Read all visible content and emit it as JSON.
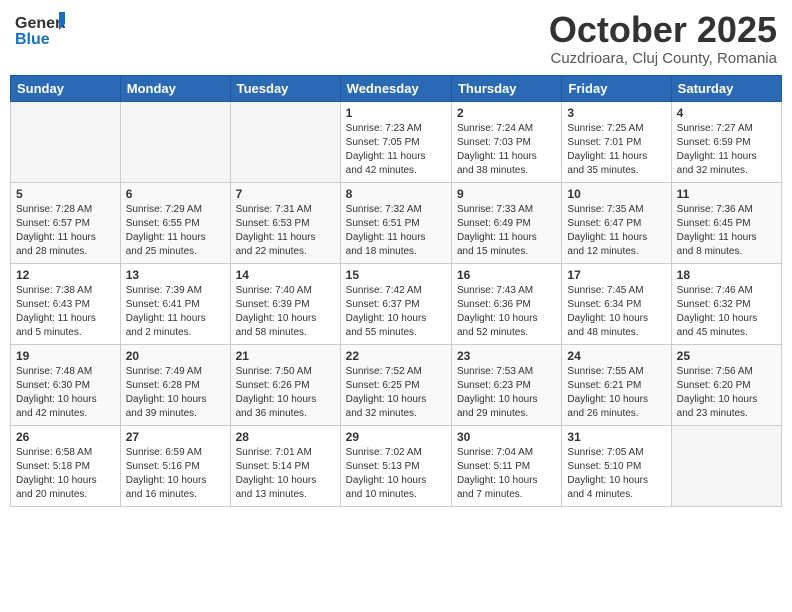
{
  "header": {
    "logo_general": "General",
    "logo_blue": "Blue",
    "month_title": "October 2025",
    "subtitle": "Cuzdrioara, Cluj County, Romania"
  },
  "weekdays": [
    "Sunday",
    "Monday",
    "Tuesday",
    "Wednesday",
    "Thursday",
    "Friday",
    "Saturday"
  ],
  "weeks": [
    [
      {
        "day": "",
        "info": ""
      },
      {
        "day": "",
        "info": ""
      },
      {
        "day": "",
        "info": ""
      },
      {
        "day": "1",
        "info": "Sunrise: 7:23 AM\nSunset: 7:05 PM\nDaylight: 11 hours\nand 42 minutes."
      },
      {
        "day": "2",
        "info": "Sunrise: 7:24 AM\nSunset: 7:03 PM\nDaylight: 11 hours\nand 38 minutes."
      },
      {
        "day": "3",
        "info": "Sunrise: 7:25 AM\nSunset: 7:01 PM\nDaylight: 11 hours\nand 35 minutes."
      },
      {
        "day": "4",
        "info": "Sunrise: 7:27 AM\nSunset: 6:59 PM\nDaylight: 11 hours\nand 32 minutes."
      }
    ],
    [
      {
        "day": "5",
        "info": "Sunrise: 7:28 AM\nSunset: 6:57 PM\nDaylight: 11 hours\nand 28 minutes."
      },
      {
        "day": "6",
        "info": "Sunrise: 7:29 AM\nSunset: 6:55 PM\nDaylight: 11 hours\nand 25 minutes."
      },
      {
        "day": "7",
        "info": "Sunrise: 7:31 AM\nSunset: 6:53 PM\nDaylight: 11 hours\nand 22 minutes."
      },
      {
        "day": "8",
        "info": "Sunrise: 7:32 AM\nSunset: 6:51 PM\nDaylight: 11 hours\nand 18 minutes."
      },
      {
        "day": "9",
        "info": "Sunrise: 7:33 AM\nSunset: 6:49 PM\nDaylight: 11 hours\nand 15 minutes."
      },
      {
        "day": "10",
        "info": "Sunrise: 7:35 AM\nSunset: 6:47 PM\nDaylight: 11 hours\nand 12 minutes."
      },
      {
        "day": "11",
        "info": "Sunrise: 7:36 AM\nSunset: 6:45 PM\nDaylight: 11 hours\nand 8 minutes."
      }
    ],
    [
      {
        "day": "12",
        "info": "Sunrise: 7:38 AM\nSunset: 6:43 PM\nDaylight: 11 hours\nand 5 minutes."
      },
      {
        "day": "13",
        "info": "Sunrise: 7:39 AM\nSunset: 6:41 PM\nDaylight: 11 hours\nand 2 minutes."
      },
      {
        "day": "14",
        "info": "Sunrise: 7:40 AM\nSunset: 6:39 PM\nDaylight: 10 hours\nand 58 minutes."
      },
      {
        "day": "15",
        "info": "Sunrise: 7:42 AM\nSunset: 6:37 PM\nDaylight: 10 hours\nand 55 minutes."
      },
      {
        "day": "16",
        "info": "Sunrise: 7:43 AM\nSunset: 6:36 PM\nDaylight: 10 hours\nand 52 minutes."
      },
      {
        "day": "17",
        "info": "Sunrise: 7:45 AM\nSunset: 6:34 PM\nDaylight: 10 hours\nand 48 minutes."
      },
      {
        "day": "18",
        "info": "Sunrise: 7:46 AM\nSunset: 6:32 PM\nDaylight: 10 hours\nand 45 minutes."
      }
    ],
    [
      {
        "day": "19",
        "info": "Sunrise: 7:48 AM\nSunset: 6:30 PM\nDaylight: 10 hours\nand 42 minutes."
      },
      {
        "day": "20",
        "info": "Sunrise: 7:49 AM\nSunset: 6:28 PM\nDaylight: 10 hours\nand 39 minutes."
      },
      {
        "day": "21",
        "info": "Sunrise: 7:50 AM\nSunset: 6:26 PM\nDaylight: 10 hours\nand 36 minutes."
      },
      {
        "day": "22",
        "info": "Sunrise: 7:52 AM\nSunset: 6:25 PM\nDaylight: 10 hours\nand 32 minutes."
      },
      {
        "day": "23",
        "info": "Sunrise: 7:53 AM\nSunset: 6:23 PM\nDaylight: 10 hours\nand 29 minutes."
      },
      {
        "day": "24",
        "info": "Sunrise: 7:55 AM\nSunset: 6:21 PM\nDaylight: 10 hours\nand 26 minutes."
      },
      {
        "day": "25",
        "info": "Sunrise: 7:56 AM\nSunset: 6:20 PM\nDaylight: 10 hours\nand 23 minutes."
      }
    ],
    [
      {
        "day": "26",
        "info": "Sunrise: 6:58 AM\nSunset: 5:18 PM\nDaylight: 10 hours\nand 20 minutes."
      },
      {
        "day": "27",
        "info": "Sunrise: 6:59 AM\nSunset: 5:16 PM\nDaylight: 10 hours\nand 16 minutes."
      },
      {
        "day": "28",
        "info": "Sunrise: 7:01 AM\nSunset: 5:14 PM\nDaylight: 10 hours\nand 13 minutes."
      },
      {
        "day": "29",
        "info": "Sunrise: 7:02 AM\nSunset: 5:13 PM\nDaylight: 10 hours\nand 10 minutes."
      },
      {
        "day": "30",
        "info": "Sunrise: 7:04 AM\nSunset: 5:11 PM\nDaylight: 10 hours\nand 7 minutes."
      },
      {
        "day": "31",
        "info": "Sunrise: 7:05 AM\nSunset: 5:10 PM\nDaylight: 10 hours\nand 4 minutes."
      },
      {
        "day": "",
        "info": ""
      }
    ]
  ]
}
